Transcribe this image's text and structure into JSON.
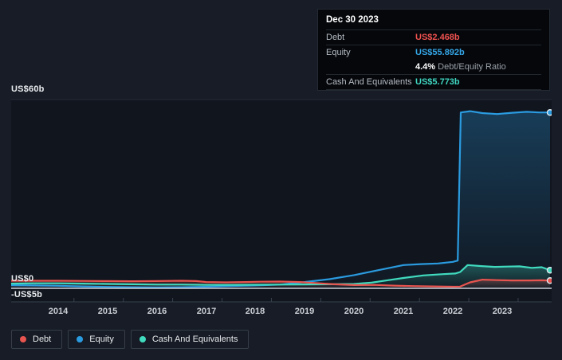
{
  "tooltip": {
    "date": "Dec 30 2023",
    "debt_label": "Debt",
    "debt_value": "US$2.468b",
    "equity_label": "Equity",
    "equity_value": "US$55.892b",
    "ratio_value": "4.4%",
    "ratio_label": " Debt/Equity Ratio",
    "cash_label": "Cash And Equivalents",
    "cash_value": "US$5.773b"
  },
  "legend": {
    "items": [
      {
        "label": "Debt",
        "color": "#e8544f"
      },
      {
        "label": "Equity",
        "color": "#2b9be0"
      },
      {
        "label": "Cash And Equivalents",
        "color": "#40dbbf"
      }
    ]
  },
  "chart_data": {
    "type": "area",
    "x_label": "",
    "y_label": "",
    "x_ticks": [
      "2014",
      "2015",
      "2016",
      "2017",
      "2018",
      "2019",
      "2020",
      "2021",
      "2022",
      "2023"
    ],
    "y_tick_labels": [
      "US$60b",
      "US$0",
      "-US$5b"
    ],
    "y_tick_values": [
      60,
      0,
      -5
    ],
    "x_min": 2013.05,
    "x_max": 2023.97,
    "y_min": -5,
    "y_max": 60,
    "grid": "horizontal-only",
    "legend_position": "bottom-left",
    "units": "US$ billions",
    "series": [
      {
        "name": "Equity",
        "color": "#2b9be0",
        "points": [
          [
            2013.05,
            1.0
          ],
          [
            2013.5,
            0.9
          ],
          [
            2014,
            0.8
          ],
          [
            2014.5,
            0.6
          ],
          [
            2015,
            0.45
          ],
          [
            2015.5,
            0.35
          ],
          [
            2016,
            0.3
          ],
          [
            2016.5,
            0.35
          ],
          [
            2017,
            0.5
          ],
          [
            2017.5,
            0.7
          ],
          [
            2018,
            0.9
          ],
          [
            2018.5,
            1.2
          ],
          [
            2019,
            2.0
          ],
          [
            2019.5,
            2.9
          ],
          [
            2020,
            4.2
          ],
          [
            2020.5,
            5.8
          ],
          [
            2021,
            7.4
          ],
          [
            2021.35,
            7.7
          ],
          [
            2021.7,
            7.9
          ],
          [
            2022,
            8.4
          ],
          [
            2022.1,
            8.8
          ],
          [
            2022.16,
            55.9
          ],
          [
            2022.35,
            56.3
          ],
          [
            2022.6,
            55.7
          ],
          [
            2022.9,
            55.4
          ],
          [
            2023.2,
            55.8
          ],
          [
            2023.5,
            56.1
          ],
          [
            2023.75,
            55.9
          ],
          [
            2023.97,
            55.892
          ]
        ]
      },
      {
        "name": "Cash And Equivalents",
        "color": "#40dbbf",
        "points": [
          [
            2013.05,
            1.5
          ],
          [
            2013.5,
            1.6
          ],
          [
            2014,
            1.6
          ],
          [
            2014.5,
            1.5
          ],
          [
            2015,
            1.4
          ],
          [
            2015.5,
            1.3
          ],
          [
            2016,
            1.2
          ],
          [
            2016.5,
            1.2
          ],
          [
            2017,
            1.1
          ],
          [
            2017.5,
            1.1
          ],
          [
            2018,
            1.15
          ],
          [
            2018.5,
            1.2
          ],
          [
            2019,
            1.25
          ],
          [
            2019.5,
            1.3
          ],
          [
            2020,
            1.4
          ],
          [
            2020.35,
            1.8
          ],
          [
            2020.7,
            2.6
          ],
          [
            2021,
            3.3
          ],
          [
            2021.4,
            4.1
          ],
          [
            2021.8,
            4.5
          ],
          [
            2022.05,
            4.7
          ],
          [
            2022.15,
            5.2
          ],
          [
            2022.3,
            7.4
          ],
          [
            2022.55,
            7.1
          ],
          [
            2022.85,
            6.8
          ],
          [
            2023.1,
            6.9
          ],
          [
            2023.35,
            7.0
          ],
          [
            2023.6,
            6.5
          ],
          [
            2023.8,
            6.7
          ],
          [
            2023.97,
            5.773
          ]
        ]
      },
      {
        "name": "Debt",
        "color": "#e8544f",
        "points": [
          [
            2013.05,
            2.4
          ],
          [
            2013.5,
            2.4
          ],
          [
            2014,
            2.4
          ],
          [
            2014.5,
            2.35
          ],
          [
            2015,
            2.3
          ],
          [
            2015.5,
            2.25
          ],
          [
            2016,
            2.3
          ],
          [
            2016.5,
            2.4
          ],
          [
            2016.8,
            2.3
          ],
          [
            2017,
            2.0
          ],
          [
            2017.4,
            1.9
          ],
          [
            2017.8,
            2.0
          ],
          [
            2018.1,
            2.1
          ],
          [
            2018.5,
            2.15
          ],
          [
            2018.9,
            2.0
          ],
          [
            2019.2,
            1.7
          ],
          [
            2019.6,
            1.3
          ],
          [
            2020,
            1.05
          ],
          [
            2020.4,
            1.1
          ],
          [
            2020.8,
            0.85
          ],
          [
            2021.2,
            0.7
          ],
          [
            2021.6,
            0.6
          ],
          [
            2022,
            0.5
          ],
          [
            2022.15,
            0.55
          ],
          [
            2022.35,
            1.9
          ],
          [
            2022.6,
            2.75
          ],
          [
            2022.9,
            2.6
          ],
          [
            2023.2,
            2.5
          ],
          [
            2023.55,
            2.5
          ],
          [
            2023.8,
            2.55
          ],
          [
            2023.97,
            2.468
          ]
        ]
      }
    ],
    "end_marker_values": {
      "Equity": 55.892,
      "Cash And Equivalents": 5.773,
      "Debt": 2.468
    }
  }
}
